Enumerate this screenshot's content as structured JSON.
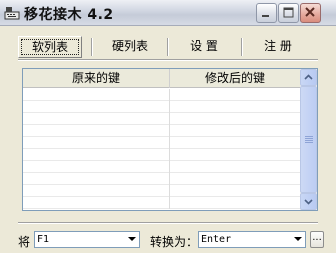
{
  "window": {
    "title": "移花接木 4.2"
  },
  "tabs": [
    {
      "label": "软列表"
    },
    {
      "label": "硬列表"
    },
    {
      "label": "设 置"
    },
    {
      "label": "注 册"
    }
  ],
  "table": {
    "headers": [
      "原来的键",
      "修改后的键"
    ],
    "rows": []
  },
  "footer": {
    "from_label": "将",
    "from_value": "F1",
    "to_label": "转换为：",
    "to_value": "Enter",
    "more_label": "..."
  },
  "icons": {
    "app": "keyboard-icon",
    "minimize": "minimize-icon",
    "maximize": "maximize-icon",
    "close": "close-icon",
    "dropdown": "chevron-down-icon",
    "scroll_up": "chevron-up-icon",
    "scroll_down": "chevron-down-icon"
  }
}
